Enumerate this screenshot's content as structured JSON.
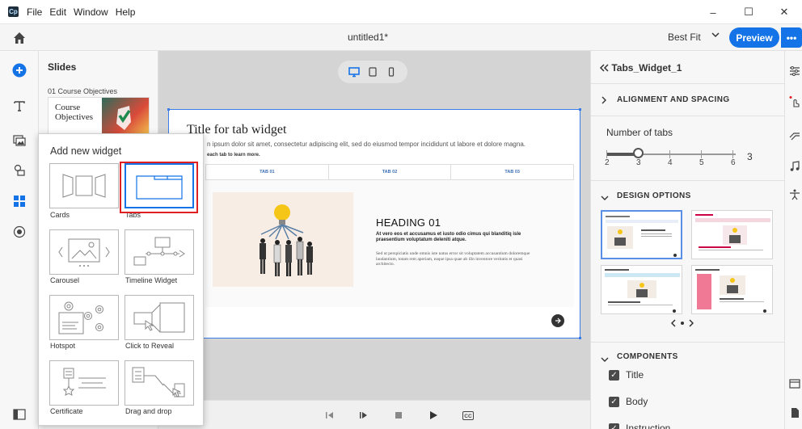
{
  "menubar": {
    "app_logo": "Cp",
    "items": [
      "File",
      "Edit",
      "Window",
      "Help"
    ],
    "window_controls": {
      "minimize": "–",
      "maximize": "☐",
      "close": "✕"
    }
  },
  "toolbar": {
    "doc_title": "untitled1*",
    "zoom": "Best Fit",
    "preview_label": "Preview",
    "more_label": "•••"
  },
  "slides_panel": {
    "title": "Slides",
    "slide_label": "01 Course Objectives",
    "thumb_text": "Course Objectives"
  },
  "popover": {
    "title": "Add new widget",
    "widgets": [
      "Cards",
      "Tabs",
      "Carousel",
      "Timeline Widget",
      "Hotspot",
      "Click to Reveal",
      "Certificate",
      "Drag and drop"
    ]
  },
  "slide": {
    "title": "Title for tab widget",
    "body": "n ipsum dolor sit amet, consectetur adipiscing elit, sed do eiusmod tempor incididunt ut labore et dolore magna.",
    "instruction": "each tab to learn more.",
    "tabs": [
      "TAB 01",
      "TAB 02",
      "TAB 03"
    ],
    "heading": "HEADING 01",
    "bold_text": "At vero eos et accusamus et iusto odio cimus qui blanditiq isle praesentium voluptatum deleniti atque.",
    "body_text": "Sed ut perspiciatis unde omnis iste natus error sit voluptatem accusantium doloremque laudantium, totam rem aperiam, eaque ipsa quae ab illo inventore veritatis et quasi architecto."
  },
  "inspector": {
    "header": "Tabs_Widget_1",
    "alignment_title": "ALIGNMENT AND SPACING",
    "number_of_tabs_label": "Number of tabs",
    "slider_ticks": [
      "2",
      "3",
      "4",
      "5",
      "6"
    ],
    "number_of_tabs_value": "3",
    "design_title": "DESIGN OPTIONS",
    "components_title": "COMPONENTS",
    "components": [
      {
        "label": "Title",
        "checked": true
      },
      {
        "label": "Body",
        "checked": true
      },
      {
        "label": "Instruction",
        "checked": true
      }
    ]
  },
  "colors": {
    "accent": "#1473e6",
    "selection_highlight": "#e02020"
  }
}
